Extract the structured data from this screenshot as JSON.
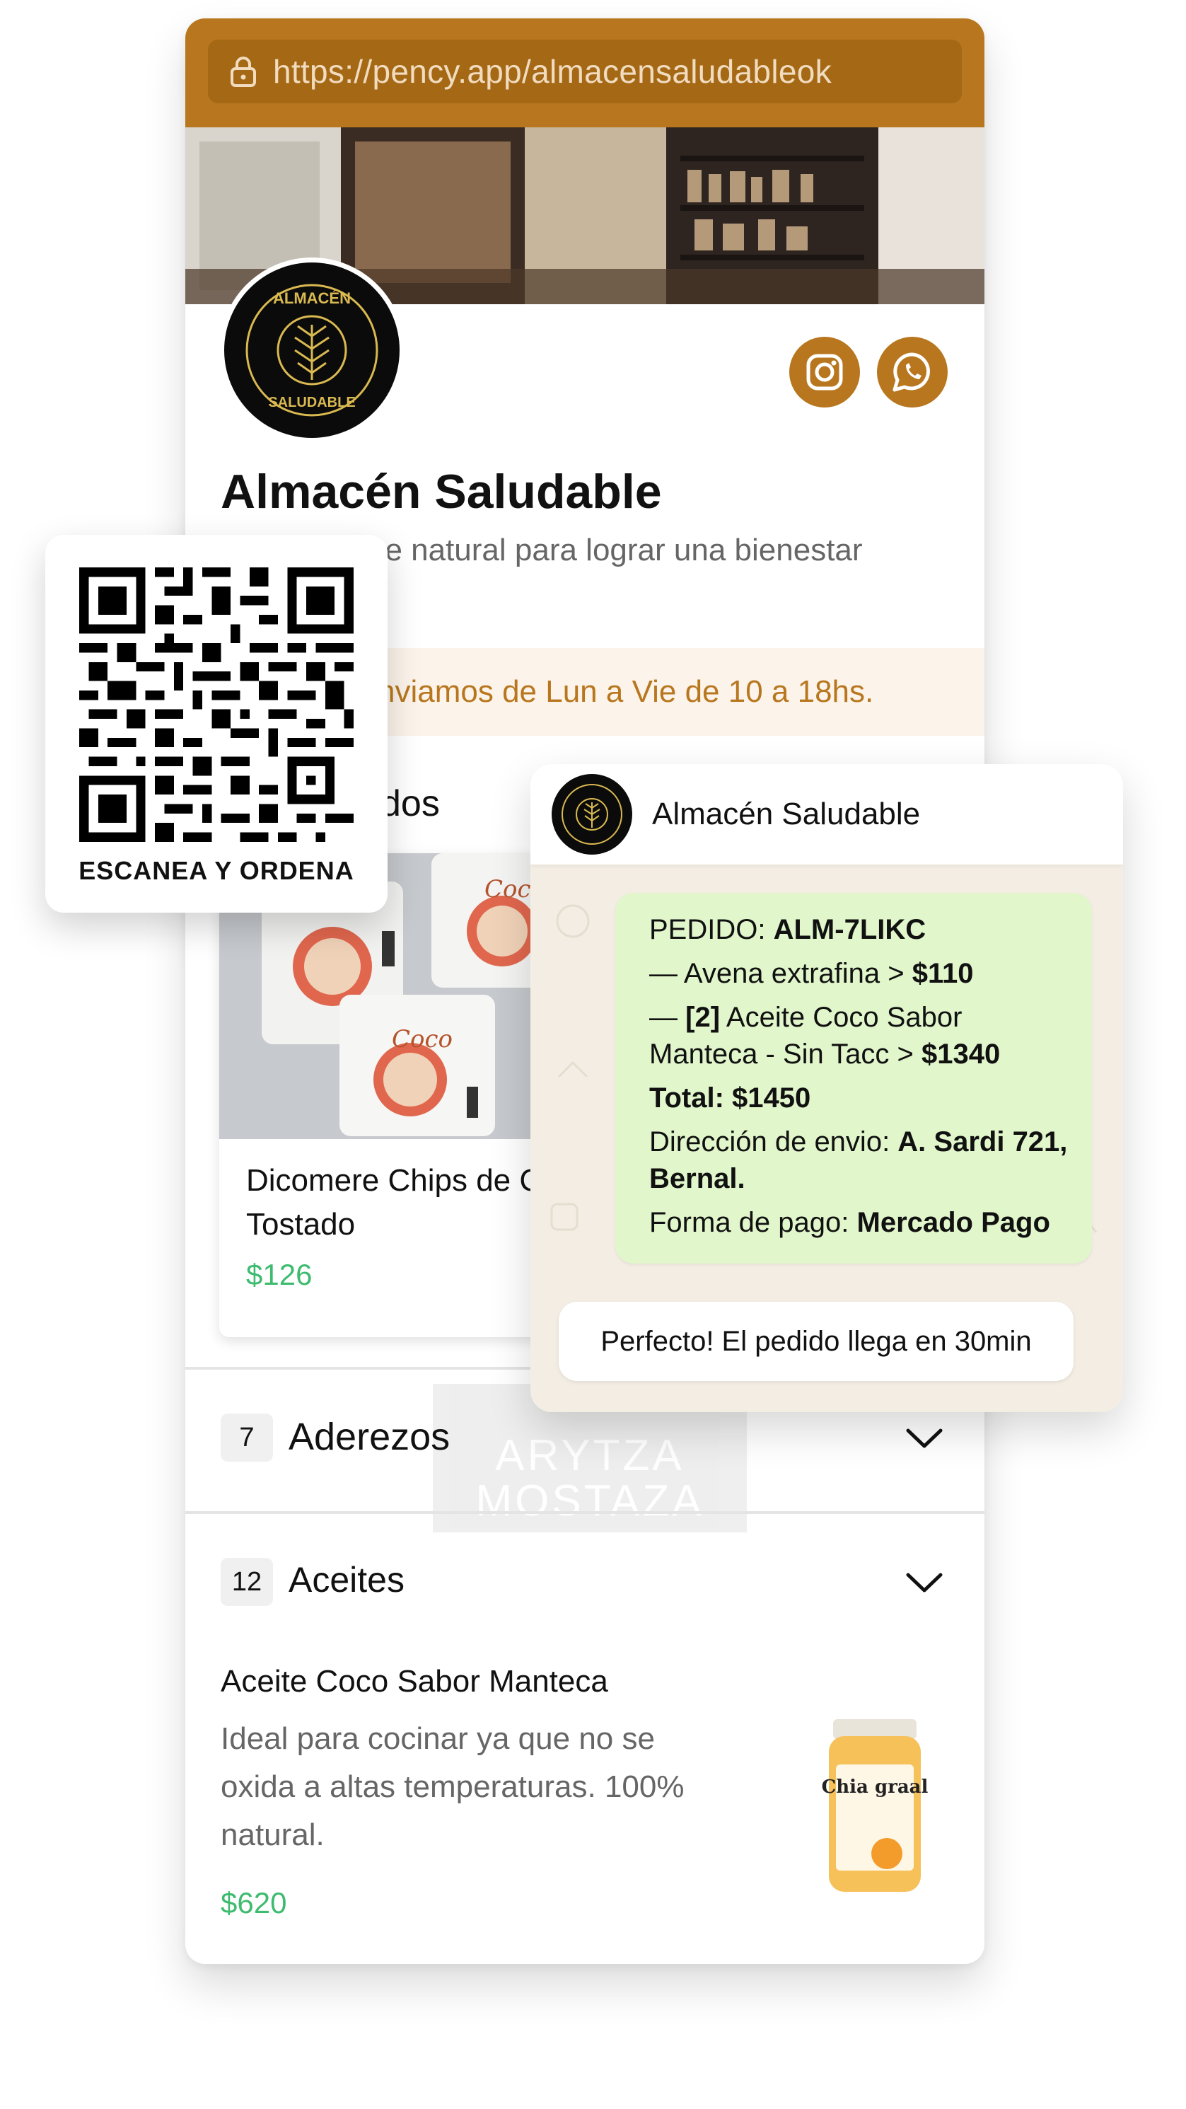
{
  "browser": {
    "url": "https://pency.app/almacensaludableok"
  },
  "store": {
    "name": "Almacén Saludable",
    "logo_text_top": "ALMACÉN",
    "logo_text_bottom": "SALUDABLE",
    "description_visible": "n un enfoque natural para lograr una bienestar óptimos.",
    "shipping_text": "nviamos de Lun a Vie de 10 a 18hs.",
    "social": [
      "instagram-icon",
      "whatsapp-icon"
    ]
  },
  "featured_section": {
    "title_visible": "dos",
    "product": {
      "name": "Dicomere Chips de Coco Tostado",
      "price": "$126",
      "package_text": "Coco Tostados"
    }
  },
  "categories": [
    {
      "count": "7",
      "name": "Aderezos",
      "ghost_text_1": "ARYTZA",
      "ghost_text_2": "MOSTAZA"
    },
    {
      "count": "12",
      "name": "Aceites"
    }
  ],
  "featured_item": {
    "title": "Aceite Coco Sabor Manteca",
    "description": "Ideal para cocinar ya que no se oxida a altas temperaturas. 100% natural.",
    "price": "$620",
    "jar_label": "Chia graal"
  },
  "qr": {
    "caption": "ESCANEA Y ORDENA"
  },
  "chat": {
    "contact_name": "Almacén Saludable",
    "order": {
      "pedido_label": "PEDIDO:",
      "pedido_code": "ALM-7LIKC",
      "line1_text": "— Avena extrafina > ",
      "line1_price": "$110",
      "line2_prefix": "— ",
      "line2_qty": "[2]",
      "line2_text": " Aceite Coco Sabor Manteca - Sin Tacc > ",
      "line2_price": "$1340",
      "total": "Total: $1450",
      "address_label": "Dirección de envio: ",
      "address_value": "A. Sardi 721, Bernal.",
      "payment_label": "Forma de pago: ",
      "payment_value": "Mercado Pago"
    },
    "reply": "Perfecto! El pedido llega en 30min"
  },
  "colors": {
    "brand": "#b8771f",
    "price": "#3dbb6e",
    "bubble": "#e1f6cb",
    "chat_bg": "#f3ede4"
  }
}
